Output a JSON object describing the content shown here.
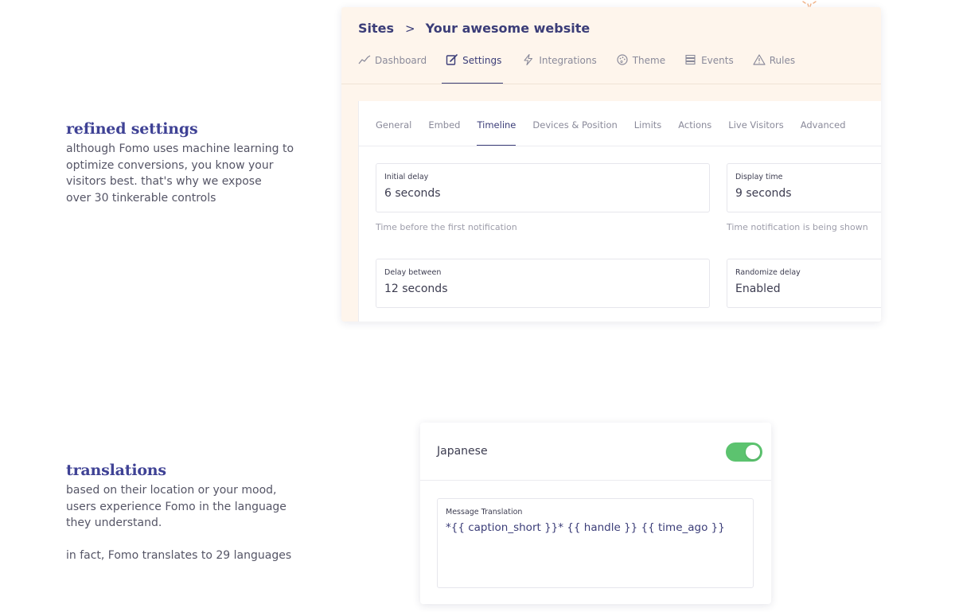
{
  "settings_copy": {
    "heading": "refined settings",
    "lines": [
      "although Fomo uses machine learning to",
      "optimize conversions, you know your",
      "visitors best. that's why we expose",
      "over 30 tinkerable controls"
    ]
  },
  "translations_copy": {
    "heading": "translations",
    "lines": [
      "based on their location or your mood,",
      "users experience Fomo in the language",
      "they understand."
    ],
    "extra": "in fact, Fomo translates to 29 languages"
  },
  "breadcrumb": {
    "root": "Sites",
    "separator": ">",
    "current": "Your awesome website"
  },
  "main_nav": [
    {
      "label": "Dashboard",
      "icon": "chart-line-icon"
    },
    {
      "label": "Settings",
      "icon": "edit-icon",
      "active": true
    },
    {
      "label": "Integrations",
      "icon": "lightning-icon"
    },
    {
      "label": "Theme",
      "icon": "palette-icon"
    },
    {
      "label": "Events",
      "icon": "list-icon"
    },
    {
      "label": "Rules",
      "icon": "warning-icon"
    }
  ],
  "sub_tabs": [
    {
      "label": "General"
    },
    {
      "label": "Embed"
    },
    {
      "label": "Timeline",
      "active": true
    },
    {
      "label": "Devices & Position"
    },
    {
      "label": "Limits"
    },
    {
      "label": "Actions"
    },
    {
      "label": "Live Visitors"
    },
    {
      "label": "Advanced"
    }
  ],
  "fields": {
    "initial_delay": {
      "label": "Initial delay",
      "value": "6 seconds",
      "hint": "Time before the first notification"
    },
    "display_time": {
      "label": "Display time",
      "value": "9 seconds",
      "hint": "Time notification is being shown"
    },
    "delay_between": {
      "label": "Delay between",
      "value": "12 seconds"
    },
    "randomize_delay": {
      "label": "Randomize delay",
      "value": "Enabled"
    }
  },
  "translation": {
    "language": "Japanese",
    "enabled": true,
    "message_label": "Message Translation",
    "message_value": "*{{ caption_short }}* {{ handle }} {{ time_ago }}"
  },
  "colors": {
    "brand": "#3f4295",
    "nav_active": "#3b3d78",
    "card_background": "#fef5ec",
    "toggle_on": "#5cc36f"
  }
}
